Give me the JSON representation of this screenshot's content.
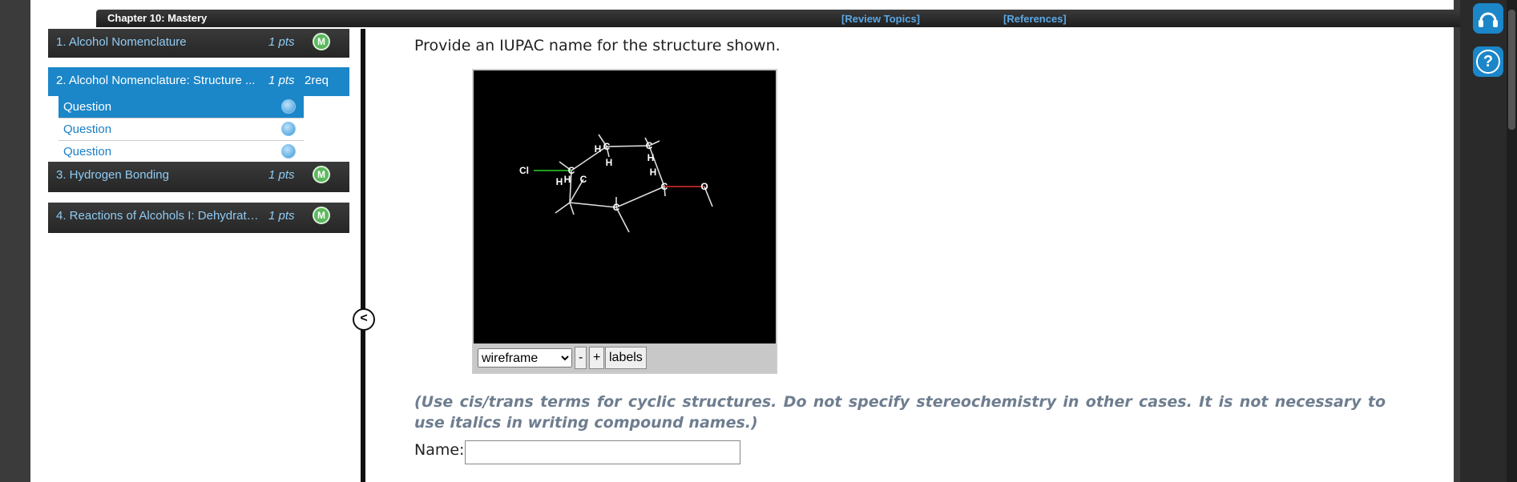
{
  "header": {
    "chapter_title": "Chapter 10: Mastery",
    "review_topics": "[Review Topics]",
    "references": "[References]"
  },
  "sidebar": {
    "items": [
      {
        "label": "1. Alcohol Nomenclature",
        "pts": "1 pts",
        "badge": "M"
      },
      {
        "label": "2. Alcohol Nomenclature: Structure ...",
        "pts": "1 pts",
        "req": "2req"
      },
      {
        "label": "3. Hydrogen Bonding",
        "pts": "1 pts",
        "badge": "M"
      },
      {
        "label": "4. Reactions of Alcohols I: Dehydratio...",
        "pts": "1 pts",
        "badge": "M"
      }
    ],
    "subitems": [
      "Question",
      "Question",
      "Question"
    ]
  },
  "collapse": "<",
  "question": {
    "prompt": "Provide an IUPAC name for the structure shown.",
    "hint": "(Use cis/trans terms for cyclic structures. Do not specify stereochemistry in other cases. It is not necessary to use italics in writing compound names.)",
    "name_label": "Name:",
    "name_value": ""
  },
  "viewer": {
    "mode": "wireframe",
    "minus": "-",
    "plus": "+",
    "labels": "labels",
    "atoms": {
      "c": "C",
      "h": "H",
      "o": "O",
      "cl": "Cl"
    }
  },
  "right": {
    "help": "?"
  }
}
